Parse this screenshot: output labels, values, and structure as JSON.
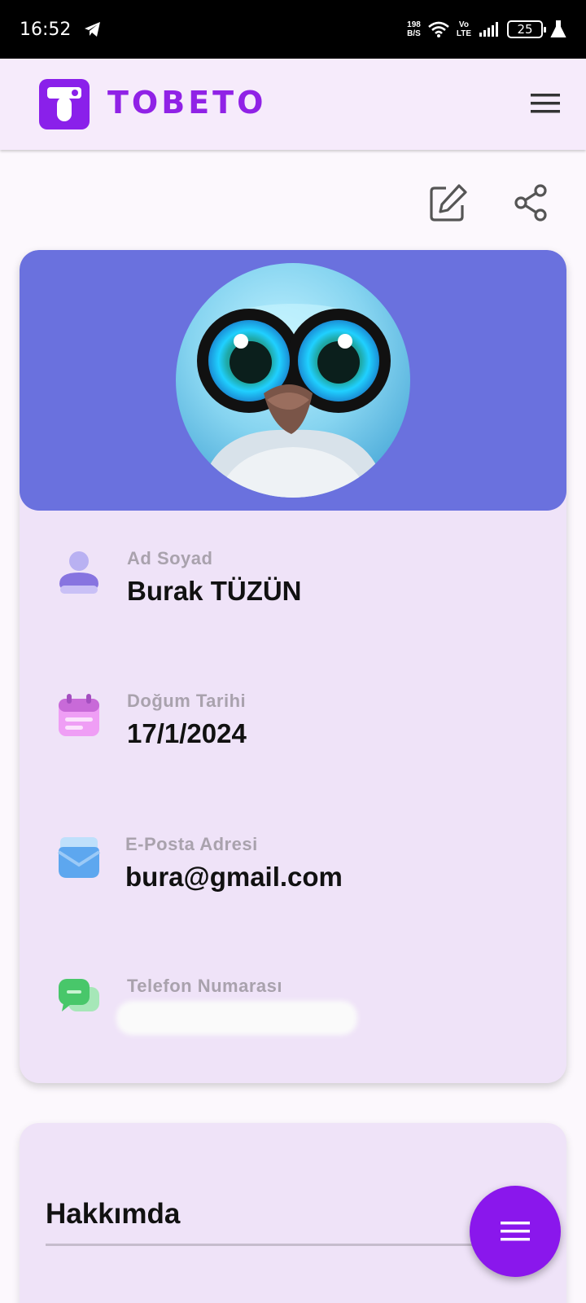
{
  "status_bar": {
    "time": "16:52",
    "net_speed_value": "198",
    "net_speed_unit": "B/S",
    "volte_top": "Vo",
    "volte_bottom": "LTE",
    "battery": "25"
  },
  "app_bar": {
    "brand": "TOBETO",
    "brand_color": "#9022e6"
  },
  "actions": {
    "edit_icon": "edit-icon",
    "share_icon": "share-icon"
  },
  "profile": {
    "header_color": "#6a71de",
    "fields": [
      {
        "label": "Ad Soyad",
        "value": "Burak TÜZÜN",
        "icon": "person-icon"
      },
      {
        "label": "Doğum Tarihi",
        "value": "17/1/2024",
        "icon": "calendar-icon"
      },
      {
        "label": "E-Posta Adresi",
        "value": "bura@gmail.com",
        "icon": "mail-icon"
      },
      {
        "label": "Telefon Numarası",
        "value": "+",
        "icon": "chat-icon"
      }
    ]
  },
  "about": {
    "title": "Hakkımda"
  },
  "fab": {
    "icon": "menu-icon",
    "color": "#8a17ec"
  }
}
